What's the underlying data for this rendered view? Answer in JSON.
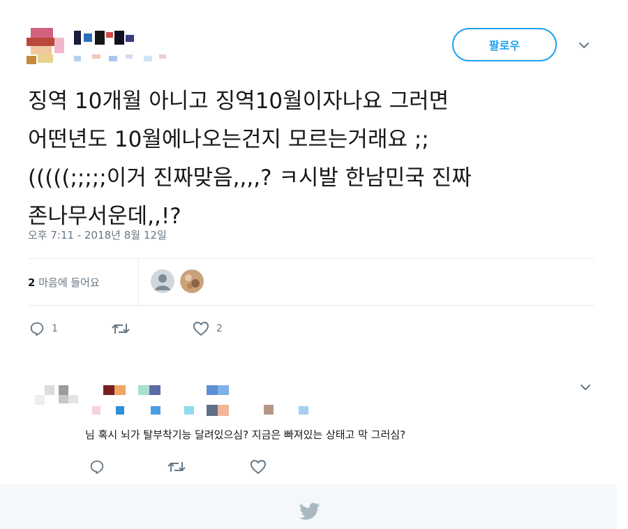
{
  "tweet": {
    "follow_label": "팔로우",
    "text": "징역 10개월 아니고 징역10월이자나요 그러면\n어떤년도 10월에나오는건지 모르는거래요 ;;\n(((((;;;;;이거 진짜맞음,,,,? ㅋ시발 한남민국 진짜\n존나무서운데,,!?",
    "timestamp": "오후 7:11 - 2018년 8월 12일",
    "likes_count": "2",
    "likes_label": "마음에 들어요",
    "actions": {
      "reply_count": "1",
      "retweet_count": "",
      "like_count": "2"
    }
  },
  "reply": {
    "text": "님 혹시 뇌가 탈부착기능 달려있으심? 지금은 빠져있는 상태고 막 그러심?"
  },
  "icons": {
    "reply": "reply-icon",
    "retweet": "retweet-icon",
    "like": "heart-icon",
    "menu": "chevron-down-icon",
    "logo": "twitter-bird-icon"
  },
  "colors": {
    "accent": "#1da1f2",
    "muted": "#657786",
    "text": "#14171a",
    "border": "#e6ecf0",
    "footer": "#f5f8fa"
  }
}
